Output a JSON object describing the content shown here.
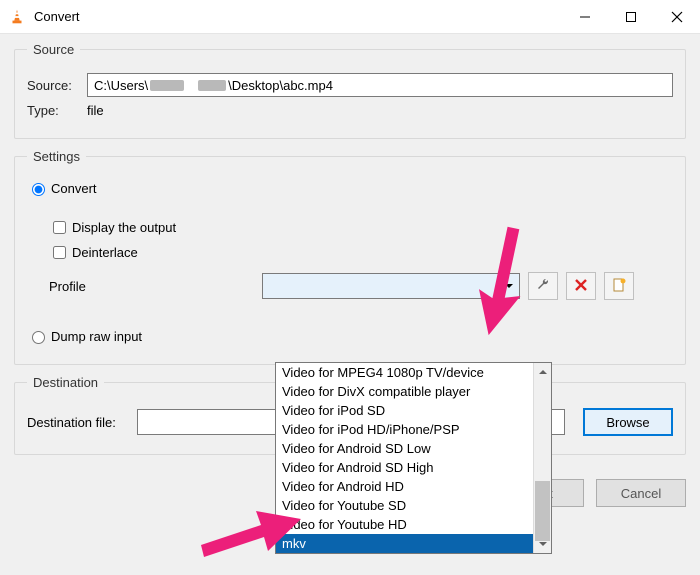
{
  "window": {
    "title": "Convert"
  },
  "source": {
    "legend": "Source",
    "source_label": "Source:",
    "source_path_prefix": "C:\\Users\\",
    "source_path_suffix": "\\Desktop\\abc.mp4",
    "type_label": "Type:",
    "type_value": "file"
  },
  "settings": {
    "legend": "Settings",
    "convert_label": "Convert",
    "display_output_label": "Display the output",
    "deinterlace_label": "Deinterlace",
    "profile_label": "Profile",
    "dump_label": "Dump raw input",
    "dropdown_items": [
      "Video for MPEG4 1080p TV/device",
      "Video for DivX compatible player",
      "Video for iPod SD",
      "Video for iPod HD/iPhone/PSP",
      "Video for Android SD Low",
      "Video for Android SD High",
      "Video for Android HD",
      "Video for Youtube SD",
      "Video for Youtube HD",
      "mkv"
    ],
    "highlighted_item": "mkv"
  },
  "destination": {
    "legend": "Destination",
    "file_label": "Destination file:",
    "browse_label": "Browse"
  },
  "buttons": {
    "start": "Start",
    "cancel": "Cancel"
  }
}
